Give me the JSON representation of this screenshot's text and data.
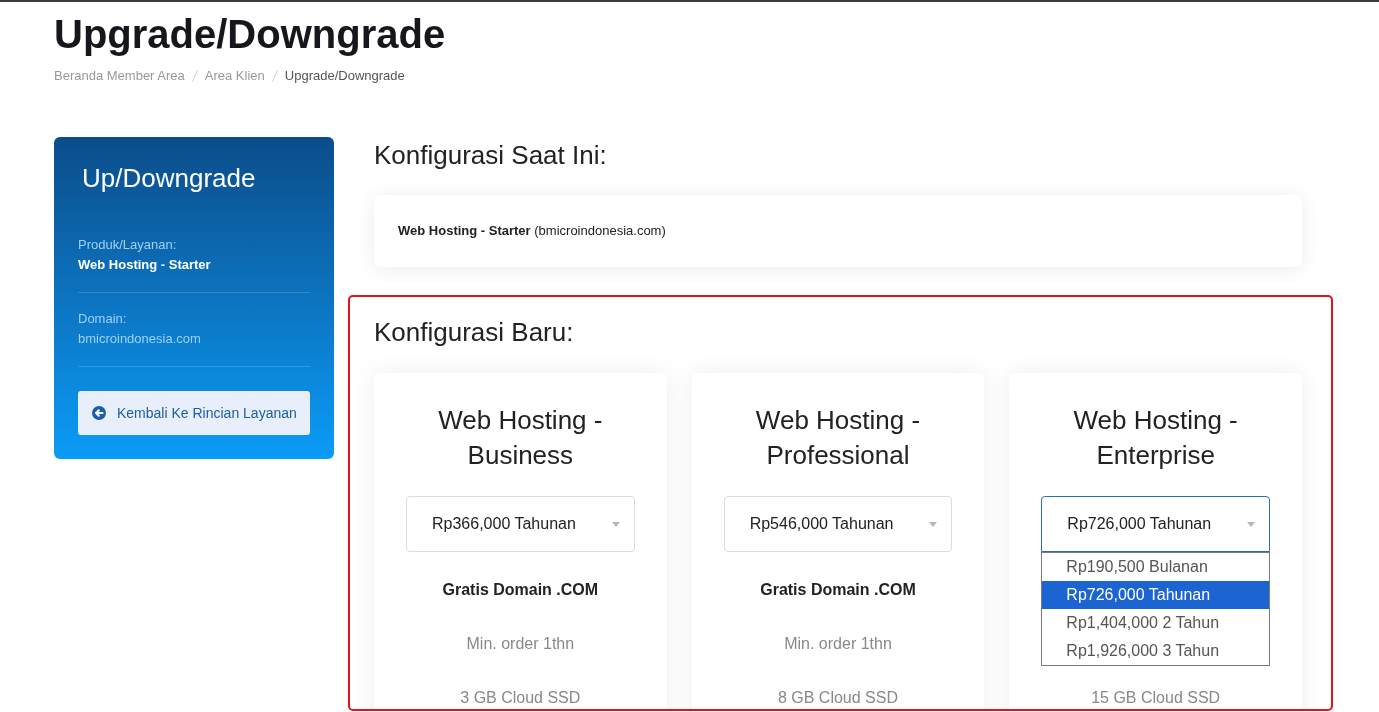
{
  "page": {
    "title": "Upgrade/Downgrade"
  },
  "breadcrumb": [
    {
      "label": "Beranda Member Area",
      "current": false
    },
    {
      "label": "Area Klien",
      "current": false
    },
    {
      "label": "Upgrade/Downgrade",
      "current": true
    }
  ],
  "sidebar": {
    "title": "Up/Downgrade",
    "fields": [
      {
        "label": "Produk/Layanan:",
        "value": "Web Hosting - Starter",
        "kind": "bold"
      },
      {
        "label": "Domain:",
        "value": "bmicroindonesia.com",
        "kind": "plain"
      }
    ],
    "back_button": {
      "label": "Kembali Ke Rincian Layanan"
    }
  },
  "current_config": {
    "heading": "Konfigurasi Saat Ini:",
    "text": "**Web Hosting - Starter** (bmicroindonesia.com)"
  },
  "new_config": {
    "heading": "Konfigurasi Baru:",
    "highlighted": true,
    "plans": [
      {
        "title": "Web Hosting - Business",
        "billing": {
          "value": "Rp366,000 Tahunan",
          "expanded": false
        },
        "features": [
          {
            "text": "Gratis Domain .COM",
            "kind": "bold"
          },
          {
            "text": "Min. order 1thn",
            "kind": "plain"
          },
          {
            "text": "3 GB Cloud SSD",
            "kind": "plain"
          }
        ]
      },
      {
        "title": "Web Hosting - Professional",
        "billing": {
          "value": "Rp546,000 Tahunan",
          "expanded": false
        },
        "features": [
          {
            "text": "Gratis Domain .COM",
            "kind": "bold"
          },
          {
            "text": "Min. order 1thn",
            "kind": "plain"
          },
          {
            "text": "8 GB Cloud SSD",
            "kind": "plain"
          }
        ]
      },
      {
        "title": "Web Hosting - Enterprise",
        "billing": {
          "value": "Rp726,000 Tahunan",
          "expanded": true,
          "options": [
            {
              "label": "Rp190,500 Bulanan",
              "selected": false
            },
            {
              "label": "Rp726,000 Tahunan",
              "selected": true
            },
            {
              "label": "Rp1,404,000 2 Tahun",
              "selected": false
            },
            {
              "label": "Rp1,926,000 3 Tahun",
              "selected": false
            }
          ]
        },
        "features": [
          {
            "text": "15 GB Cloud SSD",
            "kind": "plain"
          }
        ]
      }
    ]
  }
}
